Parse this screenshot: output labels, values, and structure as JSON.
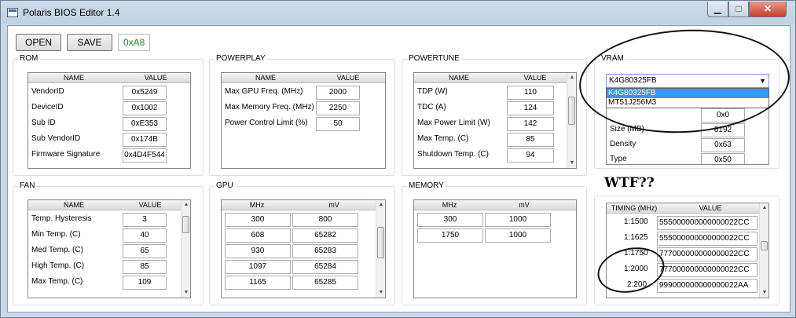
{
  "window": {
    "title": "Polaris BIOS Editor 1.4"
  },
  "toolbar": {
    "open_label": "OPEN",
    "save_label": "SAVE",
    "hex_value": "0xA8"
  },
  "rom": {
    "title": "ROM",
    "headers": [
      "NAME",
      "VALUE"
    ],
    "rows": [
      {
        "name": "VendorID",
        "value": "0x5249"
      },
      {
        "name": "DeviceID",
        "value": "0x1002"
      },
      {
        "name": "Sub ID",
        "value": "0xE353"
      },
      {
        "name": "Sub VendorID",
        "value": "0x174B"
      },
      {
        "name": "Firmware Signature",
        "value": "0x4D4F544"
      }
    ]
  },
  "powerplay": {
    "title": "POWERPLAY",
    "headers": [
      "NAME",
      "VALUE"
    ],
    "rows": [
      {
        "name": "Max GPU Freq. (MHz)",
        "value": "2000"
      },
      {
        "name": "Max Memory Freq. (MHz)",
        "value": "2250"
      },
      {
        "name": "Power Control Limit (%)",
        "value": "50"
      }
    ]
  },
  "powertune": {
    "title": "POWERTUNE",
    "headers": [
      "NAME",
      "VALUE"
    ],
    "rows": [
      {
        "name": "TDP (W)",
        "value": "110"
      },
      {
        "name": "TDC (A)",
        "value": "124"
      },
      {
        "name": "Max Power Limit (W)",
        "value": "142"
      },
      {
        "name": "Max Temp. (C)",
        "value": "85"
      },
      {
        "name": "Shutdown Temp. (C)",
        "value": "94"
      }
    ]
  },
  "vram": {
    "title": "VRAM",
    "selected": "K4G80325FB",
    "options": [
      "K4G80325FB",
      "MT51J256M3"
    ],
    "rows": [
      {
        "name": "",
        "value": "0x0"
      },
      {
        "name": "Size (MB)",
        "value": "8192"
      },
      {
        "name": "Density",
        "value": "0x63"
      },
      {
        "name": "Type",
        "value": "0x50"
      }
    ]
  },
  "fan": {
    "title": "FAN",
    "headers": [
      "NAME",
      "VALUE"
    ],
    "rows": [
      {
        "name": "Temp. Hysteresis",
        "value": "3"
      },
      {
        "name": "Min Temp. (C)",
        "value": "40"
      },
      {
        "name": "Med Temp. (C)",
        "value": "65"
      },
      {
        "name": "High Temp. (C)",
        "value": "85"
      },
      {
        "name": "Max Temp. (C)",
        "value": "109"
      }
    ]
  },
  "gpu": {
    "title": "GPU",
    "headers": [
      "MHz",
      "mV"
    ],
    "rows": [
      {
        "mhz": "300",
        "mv": "800"
      },
      {
        "mhz": "608",
        "mv": "65282"
      },
      {
        "mhz": "930",
        "mv": "65283"
      },
      {
        "mhz": "1097",
        "mv": "65284"
      },
      {
        "mhz": "1165",
        "mv": "65285"
      }
    ]
  },
  "memory": {
    "title": "MEMORY",
    "headers": [
      "MHz",
      "mV"
    ],
    "rows": [
      {
        "mhz": "300",
        "mv": "1000"
      },
      {
        "mhz": "1750",
        "mv": "1000"
      }
    ]
  },
  "annotation": {
    "text": "WTF??"
  },
  "timing": {
    "headers": [
      "TIMING (MHz)",
      "VALUE"
    ],
    "rows": [
      {
        "mhz": "1:1500",
        "value": "555000000000000022CC"
      },
      {
        "mhz": "1:1625",
        "value": "555000000000000022CC"
      },
      {
        "mhz": "1:1750",
        "value": "777000000000000022CC"
      },
      {
        "mhz": "1:2000",
        "value": "777000000000000022CC"
      },
      {
        "mhz": "2:200",
        "value": "999000000000000022AA"
      }
    ]
  }
}
